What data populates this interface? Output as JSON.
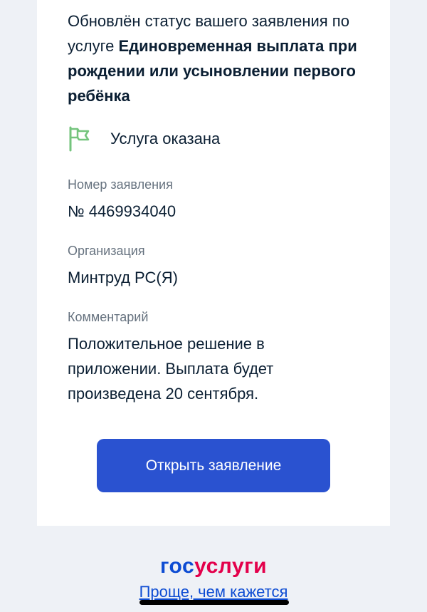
{
  "message": {
    "intro_text": "Обновлён статус вашего заявления по услуге ",
    "service_name": "Единовременная выплата при рождении или усыновлении первого ребёнка",
    "status": {
      "icon": "flag-icon",
      "text": "Услуга оказана",
      "color": "#74c47d"
    },
    "fields": {
      "number": {
        "label": "Номер заявления",
        "value": "№ 4469934040"
      },
      "organization": {
        "label": "Организация",
        "value": "Минтруд РС(Я)"
      },
      "comment": {
        "label": "Комментарий",
        "value": "Положительное решение в приложении. Выплата будет произведена 20 сентября."
      }
    },
    "open_button_label": "Открыть заявление"
  },
  "footer": {
    "logo_part1": "гос",
    "logo_part2": "услуги",
    "slogan": "Проще, чем кажется"
  },
  "colors": {
    "primary": "#2a52d0",
    "logo_blue": "#0d4cd3",
    "logo_red": "#e3004b",
    "muted": "#66727f",
    "background": "#eef1f6"
  }
}
